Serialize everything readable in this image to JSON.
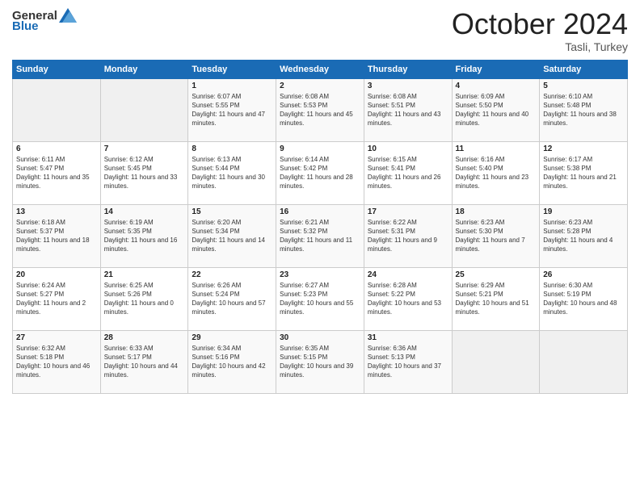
{
  "logo": {
    "text_general": "General",
    "text_blue": "Blue"
  },
  "header": {
    "month": "October 2024",
    "location": "Tasli, Turkey"
  },
  "days_of_week": [
    "Sunday",
    "Monday",
    "Tuesday",
    "Wednesday",
    "Thursday",
    "Friday",
    "Saturday"
  ],
  "weeks": [
    [
      {
        "day": "",
        "sunrise": "",
        "sunset": "",
        "daylight": ""
      },
      {
        "day": "",
        "sunrise": "",
        "sunset": "",
        "daylight": ""
      },
      {
        "day": "1",
        "sunrise": "Sunrise: 6:07 AM",
        "sunset": "Sunset: 5:55 PM",
        "daylight": "Daylight: 11 hours and 47 minutes."
      },
      {
        "day": "2",
        "sunrise": "Sunrise: 6:08 AM",
        "sunset": "Sunset: 5:53 PM",
        "daylight": "Daylight: 11 hours and 45 minutes."
      },
      {
        "day": "3",
        "sunrise": "Sunrise: 6:08 AM",
        "sunset": "Sunset: 5:51 PM",
        "daylight": "Daylight: 11 hours and 43 minutes."
      },
      {
        "day": "4",
        "sunrise": "Sunrise: 6:09 AM",
        "sunset": "Sunset: 5:50 PM",
        "daylight": "Daylight: 11 hours and 40 minutes."
      },
      {
        "day": "5",
        "sunrise": "Sunrise: 6:10 AM",
        "sunset": "Sunset: 5:48 PM",
        "daylight": "Daylight: 11 hours and 38 minutes."
      }
    ],
    [
      {
        "day": "6",
        "sunrise": "Sunrise: 6:11 AM",
        "sunset": "Sunset: 5:47 PM",
        "daylight": "Daylight: 11 hours and 35 minutes."
      },
      {
        "day": "7",
        "sunrise": "Sunrise: 6:12 AM",
        "sunset": "Sunset: 5:45 PM",
        "daylight": "Daylight: 11 hours and 33 minutes."
      },
      {
        "day": "8",
        "sunrise": "Sunrise: 6:13 AM",
        "sunset": "Sunset: 5:44 PM",
        "daylight": "Daylight: 11 hours and 30 minutes."
      },
      {
        "day": "9",
        "sunrise": "Sunrise: 6:14 AM",
        "sunset": "Sunset: 5:42 PM",
        "daylight": "Daylight: 11 hours and 28 minutes."
      },
      {
        "day": "10",
        "sunrise": "Sunrise: 6:15 AM",
        "sunset": "Sunset: 5:41 PM",
        "daylight": "Daylight: 11 hours and 26 minutes."
      },
      {
        "day": "11",
        "sunrise": "Sunrise: 6:16 AM",
        "sunset": "Sunset: 5:40 PM",
        "daylight": "Daylight: 11 hours and 23 minutes."
      },
      {
        "day": "12",
        "sunrise": "Sunrise: 6:17 AM",
        "sunset": "Sunset: 5:38 PM",
        "daylight": "Daylight: 11 hours and 21 minutes."
      }
    ],
    [
      {
        "day": "13",
        "sunrise": "Sunrise: 6:18 AM",
        "sunset": "Sunset: 5:37 PM",
        "daylight": "Daylight: 11 hours and 18 minutes."
      },
      {
        "day": "14",
        "sunrise": "Sunrise: 6:19 AM",
        "sunset": "Sunset: 5:35 PM",
        "daylight": "Daylight: 11 hours and 16 minutes."
      },
      {
        "day": "15",
        "sunrise": "Sunrise: 6:20 AM",
        "sunset": "Sunset: 5:34 PM",
        "daylight": "Daylight: 11 hours and 14 minutes."
      },
      {
        "day": "16",
        "sunrise": "Sunrise: 6:21 AM",
        "sunset": "Sunset: 5:32 PM",
        "daylight": "Daylight: 11 hours and 11 minutes."
      },
      {
        "day": "17",
        "sunrise": "Sunrise: 6:22 AM",
        "sunset": "Sunset: 5:31 PM",
        "daylight": "Daylight: 11 hours and 9 minutes."
      },
      {
        "day": "18",
        "sunrise": "Sunrise: 6:23 AM",
        "sunset": "Sunset: 5:30 PM",
        "daylight": "Daylight: 11 hours and 7 minutes."
      },
      {
        "day": "19",
        "sunrise": "Sunrise: 6:23 AM",
        "sunset": "Sunset: 5:28 PM",
        "daylight": "Daylight: 11 hours and 4 minutes."
      }
    ],
    [
      {
        "day": "20",
        "sunrise": "Sunrise: 6:24 AM",
        "sunset": "Sunset: 5:27 PM",
        "daylight": "Daylight: 11 hours and 2 minutes."
      },
      {
        "day": "21",
        "sunrise": "Sunrise: 6:25 AM",
        "sunset": "Sunset: 5:26 PM",
        "daylight": "Daylight: 11 hours and 0 minutes."
      },
      {
        "day": "22",
        "sunrise": "Sunrise: 6:26 AM",
        "sunset": "Sunset: 5:24 PM",
        "daylight": "Daylight: 10 hours and 57 minutes."
      },
      {
        "day": "23",
        "sunrise": "Sunrise: 6:27 AM",
        "sunset": "Sunset: 5:23 PM",
        "daylight": "Daylight: 10 hours and 55 minutes."
      },
      {
        "day": "24",
        "sunrise": "Sunrise: 6:28 AM",
        "sunset": "Sunset: 5:22 PM",
        "daylight": "Daylight: 10 hours and 53 minutes."
      },
      {
        "day": "25",
        "sunrise": "Sunrise: 6:29 AM",
        "sunset": "Sunset: 5:21 PM",
        "daylight": "Daylight: 10 hours and 51 minutes."
      },
      {
        "day": "26",
        "sunrise": "Sunrise: 6:30 AM",
        "sunset": "Sunset: 5:19 PM",
        "daylight": "Daylight: 10 hours and 48 minutes."
      }
    ],
    [
      {
        "day": "27",
        "sunrise": "Sunrise: 6:32 AM",
        "sunset": "Sunset: 5:18 PM",
        "daylight": "Daylight: 10 hours and 46 minutes."
      },
      {
        "day": "28",
        "sunrise": "Sunrise: 6:33 AM",
        "sunset": "Sunset: 5:17 PM",
        "daylight": "Daylight: 10 hours and 44 minutes."
      },
      {
        "day": "29",
        "sunrise": "Sunrise: 6:34 AM",
        "sunset": "Sunset: 5:16 PM",
        "daylight": "Daylight: 10 hours and 42 minutes."
      },
      {
        "day": "30",
        "sunrise": "Sunrise: 6:35 AM",
        "sunset": "Sunset: 5:15 PM",
        "daylight": "Daylight: 10 hours and 39 minutes."
      },
      {
        "day": "31",
        "sunrise": "Sunrise: 6:36 AM",
        "sunset": "Sunset: 5:13 PM",
        "daylight": "Daylight: 10 hours and 37 minutes."
      },
      {
        "day": "",
        "sunrise": "",
        "sunset": "",
        "daylight": ""
      },
      {
        "day": "",
        "sunrise": "",
        "sunset": "",
        "daylight": ""
      }
    ]
  ]
}
